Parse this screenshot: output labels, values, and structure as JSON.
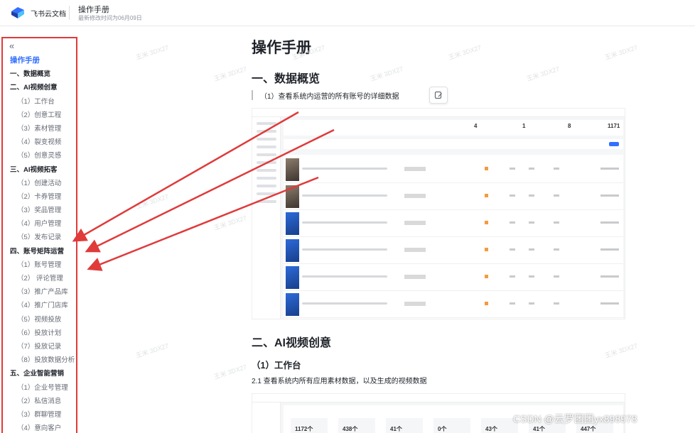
{
  "header": {
    "brand": "飞书云文档",
    "title": "操作手册",
    "subtitle": "最新修改时间为06月09日"
  },
  "sidebar": {
    "items": [
      {
        "label": "操作手册",
        "level": 0
      },
      {
        "label": "一、数据概览",
        "level": 1
      },
      {
        "label": "二、AI视频创意",
        "level": 1
      },
      {
        "label": "（1）工作台",
        "level": 2
      },
      {
        "label": "（2）创意工程",
        "level": 2
      },
      {
        "label": "（3）素材管理",
        "level": 2
      },
      {
        "label": "（4）裂变视频",
        "level": 2
      },
      {
        "label": "（5）创意灵感",
        "level": 2
      },
      {
        "label": "三、AI视频拓客",
        "level": 1
      },
      {
        "label": "（1）创建活动",
        "level": 2
      },
      {
        "label": "（2）卡券管理",
        "level": 2
      },
      {
        "label": "（3）奖品管理",
        "level": 2
      },
      {
        "label": "（4）用户管理",
        "level": 2
      },
      {
        "label": "（5）发布记录",
        "level": 2
      },
      {
        "label": "四、账号矩阵运营",
        "level": 1
      },
      {
        "label": "（1）账号管理",
        "level": 2
      },
      {
        "label": "（2） 评论管理",
        "level": 2
      },
      {
        "label": "（3）推广产品库",
        "level": 2
      },
      {
        "label": "（4）推广门店库",
        "level": 2
      },
      {
        "label": "（5）视频投放",
        "level": 2
      },
      {
        "label": "（6）投放计划",
        "level": 2
      },
      {
        "label": "（7）投放记录",
        "level": 2
      },
      {
        "label": "（8）投放数据分析",
        "level": 2
      },
      {
        "label": "五、企业智能营销",
        "level": 1
      },
      {
        "label": "（1）企业号管理",
        "level": 2
      },
      {
        "label": "（2）私信消息",
        "level": 2
      },
      {
        "label": "（3）群聊管理",
        "level": 2
      },
      {
        "label": "（4）意向客户",
        "level": 2
      }
    ]
  },
  "main": {
    "title": "操作手册",
    "section1": {
      "heading": "一、数据概览",
      "description": "（1）查看系统内运营的所有账号的详细数据",
      "stats": [
        "4",
        "1",
        "8",
        "1171"
      ]
    },
    "section2": {
      "heading": "二、AI视频创意",
      "sub_heading": "（1）工作台",
      "description": "2.1 查看系统内所有应用素材数据，以及生成的视频数据",
      "kpis": [
        "1172个",
        "438个",
        "41个",
        "0个",
        "43个",
        "41个",
        "447个"
      ]
    }
  },
  "watermark": {
    "text": "CSDN @云罗团团yx898978"
  },
  "colors": {
    "accent": "#3370ff",
    "annotation_red": "#e03a3a"
  }
}
